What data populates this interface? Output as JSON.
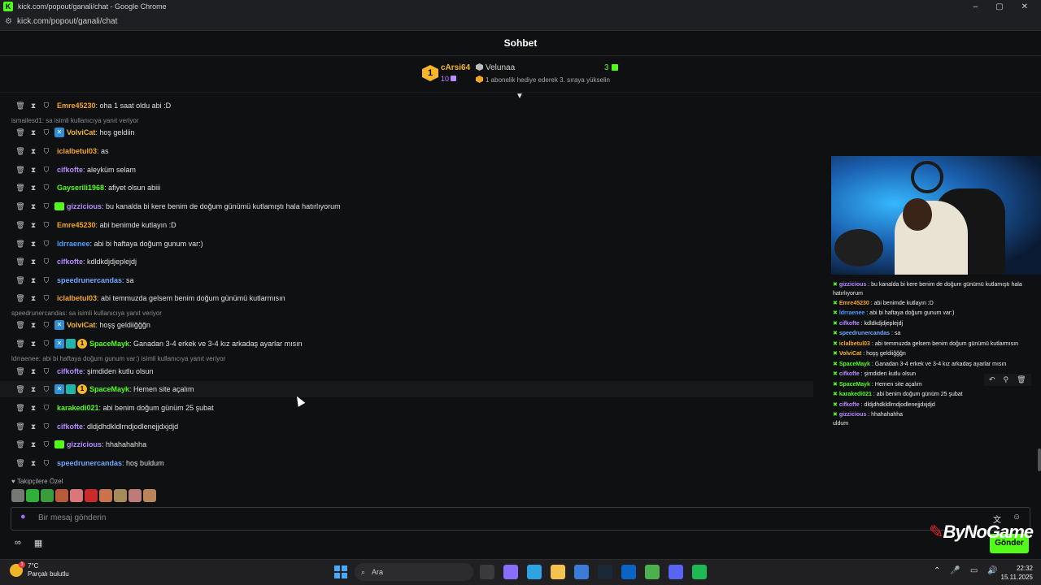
{
  "window": {
    "title": "kick.com/popout/ganali/chat - Google Chrome",
    "url": "kick.com/popout/ganali/chat",
    "controls": [
      "–",
      "▢",
      "✕"
    ]
  },
  "header": {
    "title": "Sohbet"
  },
  "pinned": {
    "rank": "1",
    "name": "cArsi64",
    "subs": "10",
    "user": "Velunaa",
    "count": "3",
    "message": "1 abonelik hediye ederek 3. sıraya yükselin"
  },
  "messages": [
    {
      "user": "Emre45230",
      "color": "#f5a623",
      "text": ": oha 1 saat oldu abi :D",
      "badges": []
    },
    {
      "reply": "ismailesd1: sa isimli kullanıcıya yanıt veriyor"
    },
    {
      "user": "VolviCat",
      "color": "#f5b629",
      "text": ": hoş geldiin",
      "badges": [
        "blue"
      ]
    },
    {
      "user": "iclalbetul03",
      "color": "#f5a623",
      "text": ": as",
      "badges": []
    },
    {
      "user": "cifkofte",
      "color": "#b78cff",
      "text": ": aleyküm selam",
      "badges": []
    },
    {
      "user": "Gayserili1968",
      "color": "#53fc18",
      "text": ": afiyet olsun abiii",
      "badges": []
    },
    {
      "user": "gizzicious",
      "color": "#b78cff",
      "text": ": bu kanalda bi kere benim de doğum günümü kutlamıştı hala hatırlıyorum",
      "badges": [
        "green"
      ]
    },
    {
      "user": "Emre45230",
      "color": "#f5a623",
      "text": ": abi benimde kutlayın :D",
      "badges": []
    },
    {
      "user": "ldrraenee",
      "color": "#4a9eff",
      "text": ": abi bi haftaya doğum gunum var:)",
      "badges": []
    },
    {
      "user": "cifkofte",
      "color": "#b78cff",
      "text": ": kdldkdjdjeplejdj",
      "badges": []
    },
    {
      "user": "speedrunercandas",
      "color": "#6fa8ff",
      "text": ": sa",
      "badges": []
    },
    {
      "user": "iclalbetul03",
      "color": "#f5a623",
      "text": ": abi temmuzda gelsem benim doğum günümü kutlarmısın",
      "badges": []
    },
    {
      "reply": "speedrunercandas: sa isimli kullanıcıya yanıt veriyor"
    },
    {
      "user": "VolviCat",
      "color": "#f5b629",
      "text": ": hoşş geldiiğğğn",
      "badges": [
        "blue"
      ]
    },
    {
      "user": "SpaceMayk",
      "color": "#53fc18",
      "text": ": Ganadan 3-4 erkek ve 3-4 kız arkadaş ayarlar mısın",
      "badges": [
        "blue",
        "teal",
        "gold"
      ]
    },
    {
      "reply": "ldrraenee: abi bi haftaya doğum gunum var:) isimli kullanıcıya yanıt veriyor"
    },
    {
      "user": "cifkofte",
      "color": "#b78cff",
      "text": ": şimdiden kutlu olsun",
      "badges": []
    },
    {
      "user": "SpaceMayk",
      "color": "#53fc18",
      "text": ": Hemen site açalım",
      "badges": [
        "blue",
        "teal",
        "gold"
      ]
    },
    {
      "user": "karakedi021",
      "color": "#53fc18",
      "text": ": abi benim doğum günüm 25 şubat",
      "badges": []
    },
    {
      "user": "cifkofte",
      "color": "#b78cff",
      "text": ": dldjdhdkldlrndjodlenejjdxjdjd",
      "badges": []
    },
    {
      "user": "gizzicious",
      "color": "#b78cff",
      "text": ": hhahahahha",
      "badges": [
        "green"
      ]
    },
    {
      "user": "speedrunercandas",
      "color": "#6fa8ff",
      "text": ": hoş buldum",
      "badges": []
    }
  ],
  "followers_label": "Takipçilere Özel",
  "emote_colors": [
    "#777",
    "#2fae3a",
    "#3a9c3a",
    "#b65a3a",
    "#d9777a",
    "#c92a2a",
    "#c8734e",
    "#a58a5a",
    "#c07a7a",
    "#b8865a"
  ],
  "input": {
    "placeholder": "Bir mesaj gönderin",
    "send": "Gönder"
  },
  "overlay": {
    "lines": [
      {
        "user": "gizzicious",
        "text": " : bu kanalda bi kere benim de doğum günümü kutlamıştı hala"
      },
      {
        "user": "",
        "text": "hatırlıyorum"
      },
      {
        "user": "Emre45230",
        "text": " : abi benimde kutlayın :D"
      },
      {
        "user": "ldrraenee",
        "text": " : abi bi haftaya doğum gunum var:)"
      },
      {
        "user": "cifkofte",
        "text": " : kdldkdjdjeplejdj"
      },
      {
        "user": "speedrunercandas",
        "text": " : sa"
      },
      {
        "user": "iclalbetul03",
        "text": " : abi temmuzda gelsem benim doğum günümü kutlarmısın"
      },
      {
        "user": "VolviCat",
        "text": " : hoşş geldiiğğğn"
      },
      {
        "user": "SpaceMayk",
        "text": " : Ganadan 3-4 erkek ve 3-4 kız arkadaş ayarlar mısın"
      },
      {
        "user": "cifkofte",
        "text": " : şimdiden kutlu olsun"
      },
      {
        "user": "SpaceMayk",
        "text": " : Hemen site açalım"
      },
      {
        "user": "karakedi021",
        "text": " : abi benim doğum günüm 25 şubat"
      },
      {
        "user": "cifkofte",
        "text": " : dldjdhdkldlrndjodlenejjdxjdjd"
      },
      {
        "user": "gizzicious",
        "text": " : hhahahahha"
      },
      {
        "user": "",
        "text": "uldum"
      }
    ]
  },
  "brand": "ByNoGame",
  "taskbar": {
    "temp": "7°C",
    "weather": "Parçalı bulutlu",
    "search": "Ara",
    "time": "22:32",
    "date": "15.11.2025"
  }
}
